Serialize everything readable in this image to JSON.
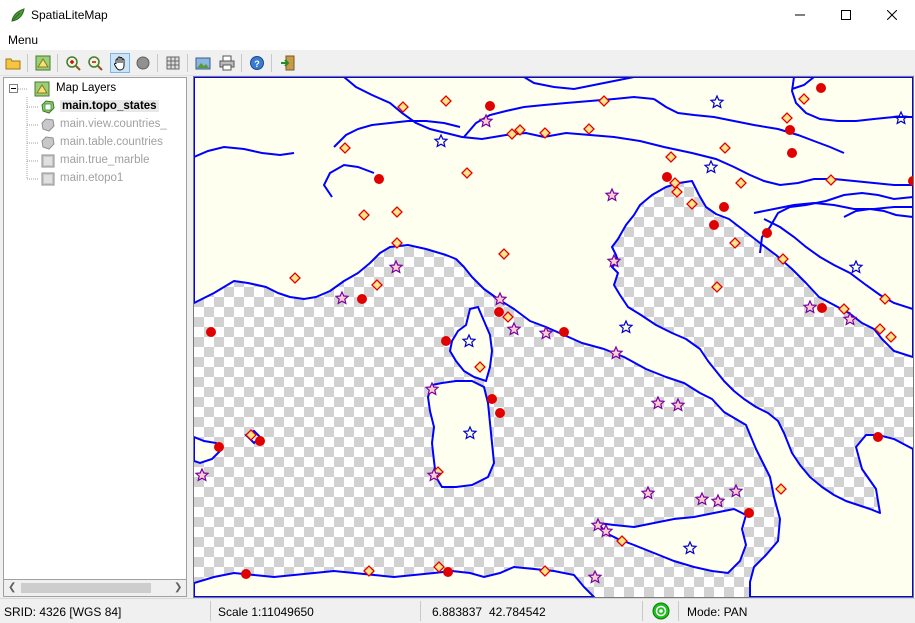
{
  "window": {
    "title": "SpatiaLiteMap"
  },
  "menubar": {
    "menu_label": "Menu"
  },
  "toolbar": {
    "buttons": [
      "open-icon",
      "layers-icon",
      "zoom-in-icon",
      "zoom-out-icon",
      "pan-hand-icon",
      "identify-icon",
      "grid-icon",
      "image-icon",
      "print-icon",
      "info-icon",
      "exit-icon"
    ]
  },
  "tree": {
    "root_label": "Map Layers",
    "layers": [
      {
        "label": "main.topo_states",
        "enabled": true
      },
      {
        "label": "main.view.countries_",
        "enabled": false
      },
      {
        "label": "main.table.countries",
        "enabled": false
      },
      {
        "label": "main.true_marble",
        "enabled": false
      },
      {
        "label": "main.etopo1",
        "enabled": false
      }
    ]
  },
  "status": {
    "srid": "SRID: 4326 [WGS 84]",
    "scale": "Scale 1:11049650",
    "lon": "6.883837",
    "lat": "42.784542",
    "mode": "Mode: PAN"
  },
  "colors": {
    "land": "#fffff0",
    "border": "#0000ff",
    "point_red": "#e00000",
    "diamond_fill": "#ffe48a",
    "star": "#0000cc"
  }
}
